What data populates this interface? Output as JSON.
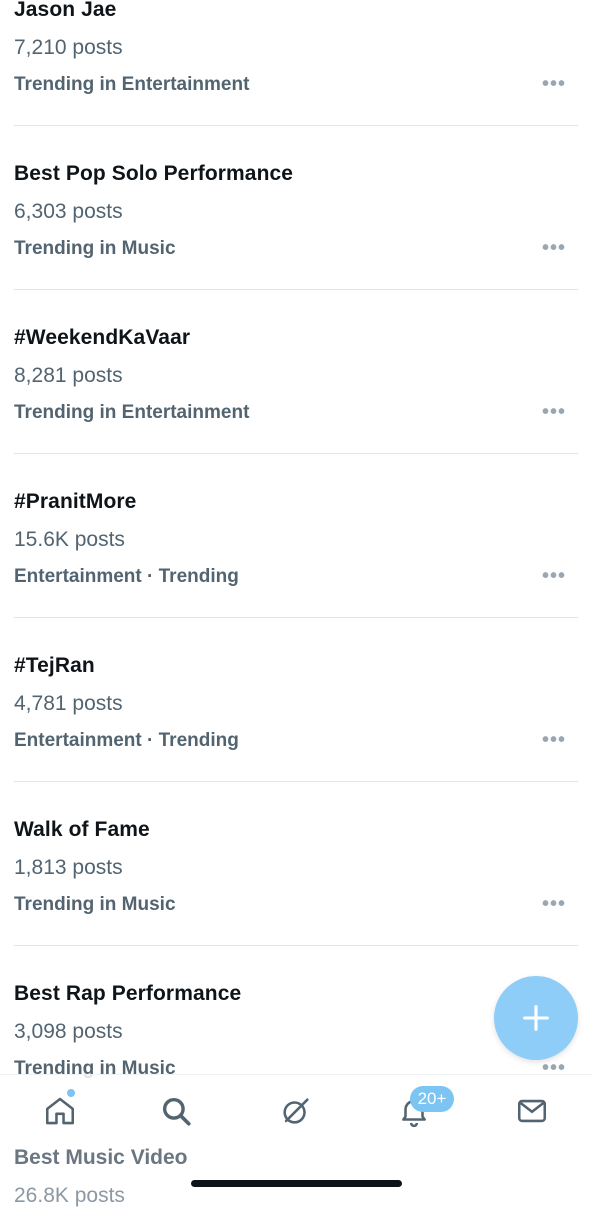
{
  "trends": [
    {
      "title": "Jason Jae",
      "count": "7,210 posts",
      "context": "Trending in Entertainment",
      "more": "•••"
    },
    {
      "title": "Best Pop Solo Performance",
      "count": "6,303 posts",
      "context": "Trending in Music",
      "more": "•••"
    },
    {
      "title": "#WeekendKaVaar",
      "count": "8,281 posts",
      "context": "Trending in Entertainment",
      "more": "•••"
    },
    {
      "title": "#PranitMore",
      "count": "15.6K posts",
      "context": "Entertainment · Trending",
      "more": "•••"
    },
    {
      "title": "#TejRan",
      "count": "4,781 posts",
      "context": "Entertainment · Trending",
      "more": "•••"
    },
    {
      "title": "Walk of Fame",
      "count": "1,813 posts",
      "context": "Trending in Music",
      "more": "•••"
    },
    {
      "title": "Best Rap Performance",
      "count": "3,098 posts",
      "context": "Trending in Music",
      "more": "•••"
    }
  ],
  "partial_trend": {
    "title": "Best Music Video",
    "count": "26.8K posts"
  },
  "nav": {
    "items": [
      {
        "icon": "home-icon"
      },
      {
        "icon": "search-icon"
      },
      {
        "icon": "grok-icon"
      },
      {
        "icon": "bell-icon"
      },
      {
        "icon": "mail-icon"
      }
    ],
    "notification_badge": "20+"
  },
  "fab": {
    "icon": "plus-icon"
  },
  "colors": {
    "accent": "#1d9bf0",
    "fab": "#8ecdf7",
    "badge": "#7cc4f2",
    "muted": "#536471"
  }
}
